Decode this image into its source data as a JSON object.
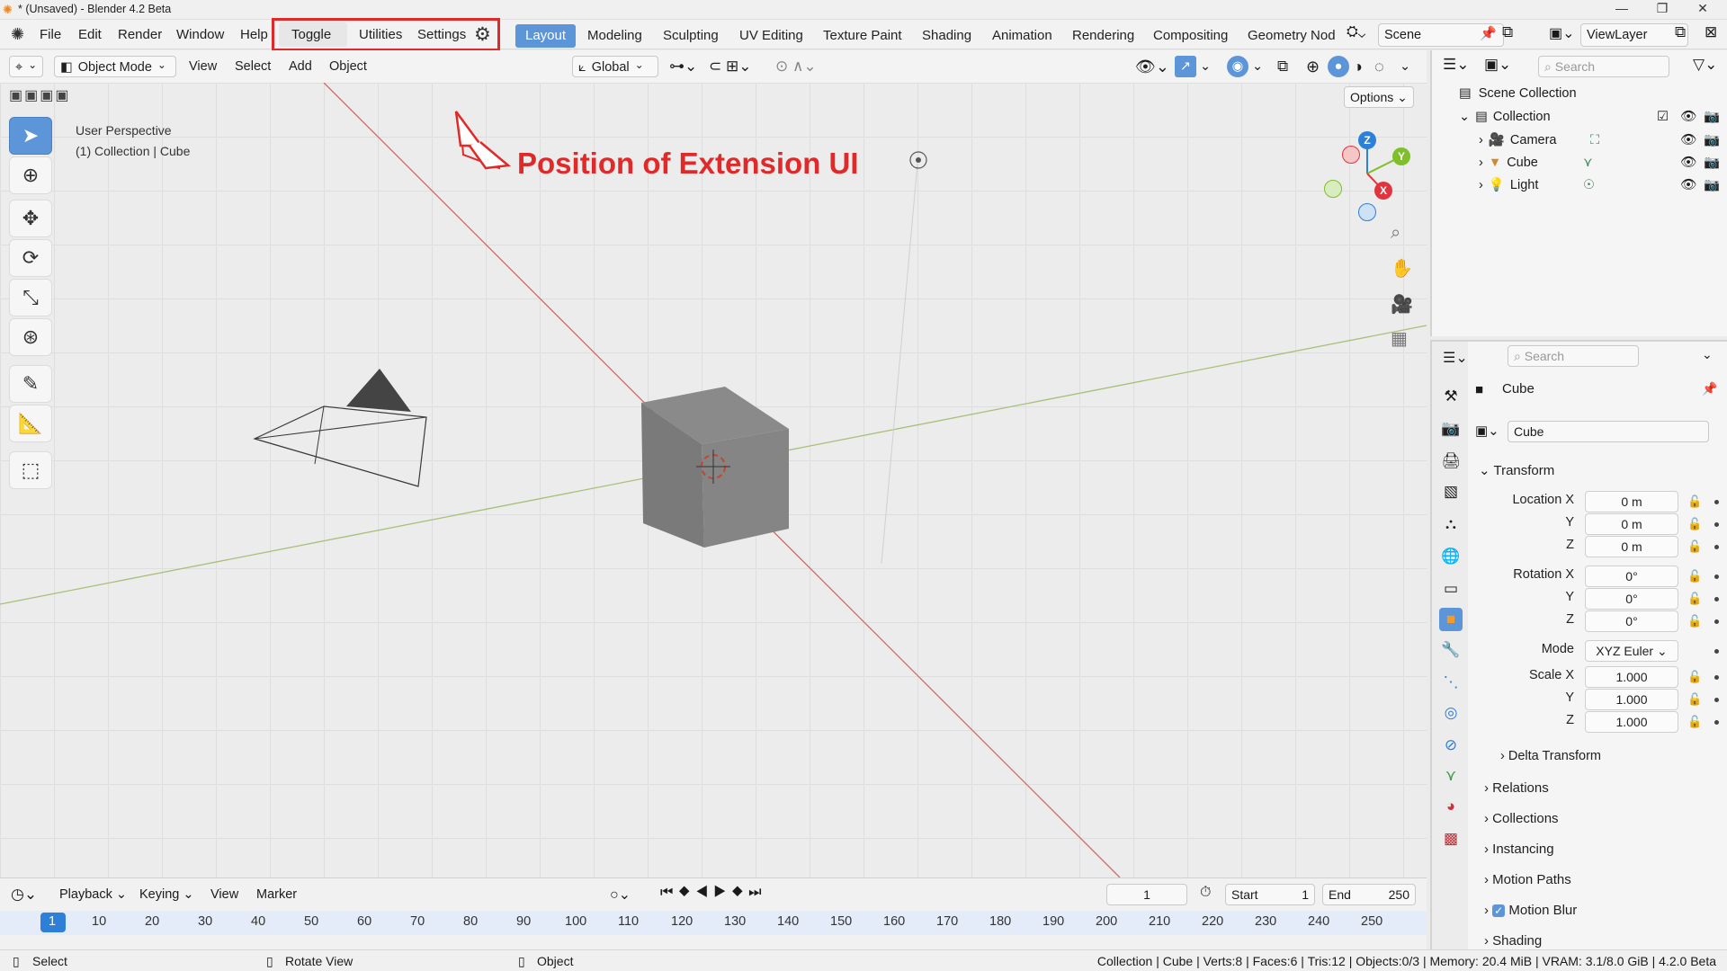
{
  "window": {
    "title": "* (Unsaved) - Blender 4.2 Beta",
    "minimize": "—",
    "maximize": "❐",
    "close": "✕"
  },
  "menu": [
    "File",
    "Edit",
    "Render",
    "Window",
    "Help"
  ],
  "extension": {
    "items": [
      "Toggle",
      "Utilities",
      "Settings"
    ],
    "highlight_color": "#e02a2a"
  },
  "workspaces": [
    "Layout",
    "Modeling",
    "Sculpting",
    "UV Editing",
    "Texture Paint",
    "Shading",
    "Animation",
    "Rendering",
    "Compositing",
    "Geometry Nod"
  ],
  "scene": {
    "name": "Scene",
    "viewlayer": "ViewLayer"
  },
  "header": {
    "mode": "Object Mode",
    "menus": [
      "View",
      "Select",
      "Add",
      "Object"
    ],
    "orientation": "Global",
    "options": "Options"
  },
  "viewport": {
    "perspective": "User Perspective",
    "context": "(1) Collection | Cube",
    "annotation": "Position of Extension UI"
  },
  "gizmo": {
    "z": "Z",
    "y": "Y",
    "x": "X"
  },
  "outliner": {
    "search": "Search",
    "scene_collection": "Scene Collection",
    "collection": "Collection",
    "objects": [
      "Camera",
      "Cube",
      "Light"
    ]
  },
  "properties": {
    "search": "Search",
    "object": "Cube",
    "data_name": "Cube",
    "transform": "Transform",
    "location": {
      "label": "Location X",
      "x": "0 m",
      "y": "0 m",
      "z": "0 m"
    },
    "rotation": {
      "label": "Rotation X",
      "x": "0°",
      "y": "0°",
      "z": "0°"
    },
    "mode_label": "Mode",
    "mode": "XYZ Euler",
    "scale": {
      "label": "Scale X",
      "x": "1.000",
      "y": "1.000",
      "z": "1.000"
    },
    "axis": {
      "y": "Y",
      "z": "Z"
    },
    "sections": [
      "Delta Transform",
      "Relations",
      "Collections",
      "Instancing",
      "Motion Paths",
      "Motion Blur",
      "Shading"
    ]
  },
  "timeline": {
    "playback": "Playback",
    "keying": "Keying",
    "view": "View",
    "marker": "Marker",
    "current": "1",
    "start_label": "Start",
    "start": "1",
    "end_label": "End",
    "end": "250",
    "frames": [
      "1",
      "10",
      "20",
      "30",
      "40",
      "50",
      "60",
      "70",
      "80",
      "90",
      "100",
      "110",
      "120",
      "130",
      "140",
      "150",
      "160",
      "170",
      "180",
      "190",
      "200",
      "210",
      "220",
      "230",
      "240",
      "250"
    ]
  },
  "status": {
    "select": "Select",
    "rotate": "Rotate View",
    "object": "Object",
    "info": "Collection | Cube | Verts:8 | Faces:6 | Tris:12 | Objects:0/3 | Memory: 20.4 MiB | VRAM: 3.1/8.0 GiB | 4.2.0 Beta"
  },
  "colors": {
    "accent": "#5c95d8",
    "x_axis": "#e0353f",
    "y_axis": "#7fbf2a",
    "z_axis": "#2d7fd8"
  }
}
